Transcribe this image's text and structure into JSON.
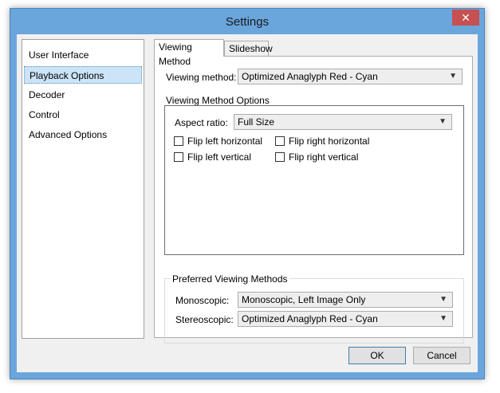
{
  "window": {
    "title": "Settings",
    "close_symbol": "✕"
  },
  "sidebar": {
    "items": [
      {
        "label": "User Interface"
      },
      {
        "label": "Playback Options"
      },
      {
        "label": "Decoder"
      },
      {
        "label": "Control"
      },
      {
        "label": "Advanced Options"
      }
    ],
    "selected": "Playback Options"
  },
  "tabs": [
    {
      "label": "Viewing Method"
    },
    {
      "label": "Slideshow"
    }
  ],
  "viewing_method": {
    "label": "Viewing method:",
    "value": "Optimized Anaglyph Red - Cyan"
  },
  "options_group": {
    "title": "Viewing Method Options",
    "aspect_label": "Aspect ratio:",
    "aspect_value": "Full Size",
    "checkboxes": [
      {
        "label": "Flip left horizontal",
        "checked": false
      },
      {
        "label": "Flip right horizontal",
        "checked": false
      },
      {
        "label": "Flip left vertical",
        "checked": false
      },
      {
        "label": "Flip right vertical",
        "checked": false
      }
    ]
  },
  "preferred_group": {
    "title": "Preferred Viewing Methods",
    "mono_label": "Monoscopic:",
    "mono_value": "Monoscopic, Left Image Only",
    "stereo_label": "Stereoscopic:",
    "stereo_value": "Optimized Anaglyph Red - Cyan"
  },
  "buttons": {
    "ok": "OK",
    "cancel": "Cancel"
  }
}
